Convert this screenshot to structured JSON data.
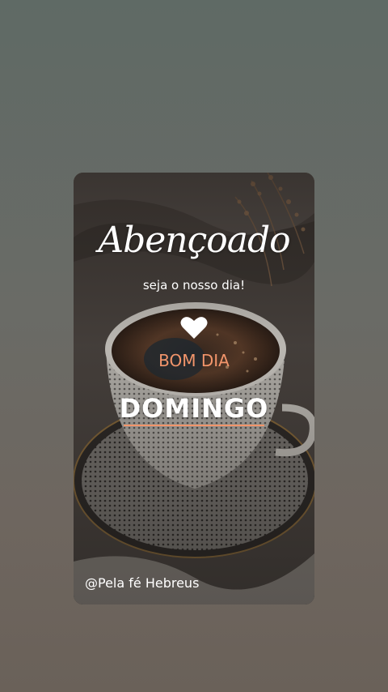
{
  "card": {
    "title_script": "Abençoado",
    "subtitle": "seja o nosso dia!",
    "greeting": "BOM DIA",
    "day": "DOMINGO",
    "handle": "@Pela fé Hebreus",
    "heart_icon": "heart-icon"
  },
  "colors": {
    "accent": "#f2956b",
    "text": "#ffffff"
  }
}
